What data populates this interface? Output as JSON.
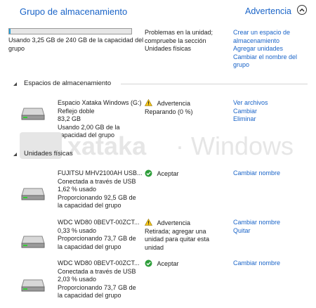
{
  "header": {
    "title": "Grupo de almacenamiento",
    "status": "Advertencia"
  },
  "pool": {
    "usage_fraction": 0.0135,
    "usage_lines": [
      "Usando 3,25 GB de 240 GB de la capacidad del",
      "grupo"
    ],
    "problem_lines": [
      "Problemas en la unidad;",
      "compruebe la sección",
      "Unidades físicas"
    ],
    "actions": [
      "Crear un espacio de",
      "almacenamiento",
      "Agregar unidades",
      "Cambiar el nombre del",
      "grupo"
    ]
  },
  "spaces_section": {
    "title": "Espacios de almacenamiento",
    "space": {
      "name": "Espacio Xataka Windows (G:)",
      "layout": "Reflejo doble",
      "size": "83,2 GB",
      "usage_lines": [
        "Usando 2,00 GB de la",
        "capacidad del grupo"
      ],
      "status": "Advertencia",
      "status_detail": "Reparando (0 %)",
      "actions": [
        "Ver archivos",
        "Cambiar",
        "Eliminar"
      ]
    }
  },
  "drives_section": {
    "title": "Unidades físicas",
    "drives": [
      {
        "name": "FUJITSU MHV2100AH USB...",
        "lines": [
          "Conectada a través de USB",
          "1,62 % usado",
          "Proporcionando 92,5 GB de",
          "la capacidad del grupo"
        ],
        "status": "Aceptar",
        "status_icon": "ok-icon",
        "status_detail": [],
        "actions": [
          "Cambiar nombre"
        ]
      },
      {
        "name": "WDC WD80 0BEVT-00ZCT...",
        "lines": [
          "0,33 % usado",
          "Proporcionando 73,7 GB de",
          "la capacidad del grupo"
        ],
        "status": "Advertencia",
        "status_icon": "warning-icon",
        "status_detail": [
          "Retirada; agregar una",
          "unidad para quitar esta",
          "unidad"
        ],
        "actions": [
          "Cambiar nombre",
          "Quitar"
        ]
      },
      {
        "name": "WDC WD80 0BEVT-00ZCT...",
        "lines": [
          "Conectada a través de USB",
          "2,03 % usado",
          "Proporcionando 73,7 GB de",
          "la capacidad del grupo"
        ],
        "status": "Aceptar",
        "status_icon": "ok-icon",
        "status_detail": [],
        "actions": [
          "Cambiar nombre"
        ]
      }
    ]
  },
  "watermark_text": "xataka · Windows",
  "colors": {
    "link": "#1a64c8",
    "progress": "#26a0da",
    "ok": "#2e9e3a",
    "warning": "#f5c518"
  }
}
